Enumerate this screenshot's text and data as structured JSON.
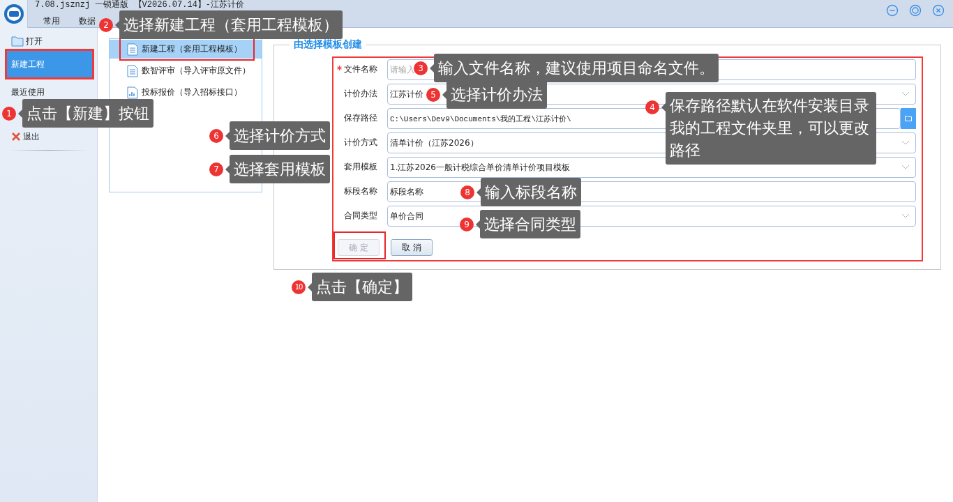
{
  "window": {
    "title": "7.08.jsznzj 一锁通版 【V2026.07.14】-江苏计价"
  },
  "menu": [
    {
      "label": "常用"
    },
    {
      "label": "数据"
    }
  ],
  "sidebar": {
    "items": [
      {
        "label": "打开",
        "kind": "open",
        "selected": false,
        "highlighted": false
      },
      {
        "label": "新建工程",
        "kind": "plain",
        "selected": true,
        "highlighted": true
      },
      {
        "label": "最近使用",
        "kind": "plain",
        "selected": false,
        "highlighted": false
      },
      {
        "label": "退出",
        "kind": "exit",
        "selected": false,
        "highlighted": false
      }
    ]
  },
  "templates": [
    {
      "label": "新建工程（套用工程模板）",
      "kind": "document",
      "selected": true,
      "highlighted": true
    },
    {
      "label": "数智评审（导入评审原文件）",
      "kind": "document",
      "selected": false,
      "highlighted": false
    },
    {
      "label": "投标报价（导入招标接口）",
      "kind": "chart",
      "selected": false,
      "highlighted": false
    }
  ],
  "group_title": "由选择模板创建",
  "form": {
    "fields": [
      {
        "label": "文件名称",
        "required": true,
        "kind": "text",
        "placeholder": "请输入"
      },
      {
        "label": "计价办法",
        "required": false,
        "kind": "select",
        "value": "江苏计价"
      },
      {
        "label": "保存路径",
        "required": false,
        "kind": "folder",
        "value": "C:\\Users\\Dev9\\Documents\\我的工程\\江苏计价\\"
      },
      {
        "label": "计价方式",
        "required": false,
        "kind": "select",
        "value": "清单计价（江苏2026）"
      },
      {
        "label": "套用模板",
        "required": false,
        "kind": "select",
        "value": "1.江苏2026一般计税综合单价清单计价项目模板"
      },
      {
        "label": "标段名称",
        "required": false,
        "kind": "text",
        "value": "标段名称"
      },
      {
        "label": "合同类型",
        "required": false,
        "kind": "select",
        "value": "单价合同"
      }
    ],
    "buttons": [
      {
        "label": "确 定",
        "disabled": true,
        "highlighted": true
      },
      {
        "label": "取 消",
        "disabled": false,
        "highlighted": false
      }
    ]
  },
  "callouts": [
    {
      "number": "1",
      "text": "点击【新建】按钮"
    },
    {
      "number": "2",
      "text": "选择新建工程（套用工程模板）"
    },
    {
      "number": "3",
      "text": "输入文件名称，建议使用项目命名文件。"
    },
    {
      "number": "4",
      "text": "保存路径默认在软件安装目录我的工程文件夹里，可以更改路径"
    },
    {
      "number": "5",
      "text": "选择计价办法"
    },
    {
      "number": "6",
      "text": "选择计价方式"
    },
    {
      "number": "7",
      "text": "选择套用模板"
    },
    {
      "number": "8",
      "text": "输入标段名称"
    },
    {
      "number": "9",
      "text": "选择合同类型"
    },
    {
      "number": "10",
      "text": "点击【确定】"
    }
  ]
}
